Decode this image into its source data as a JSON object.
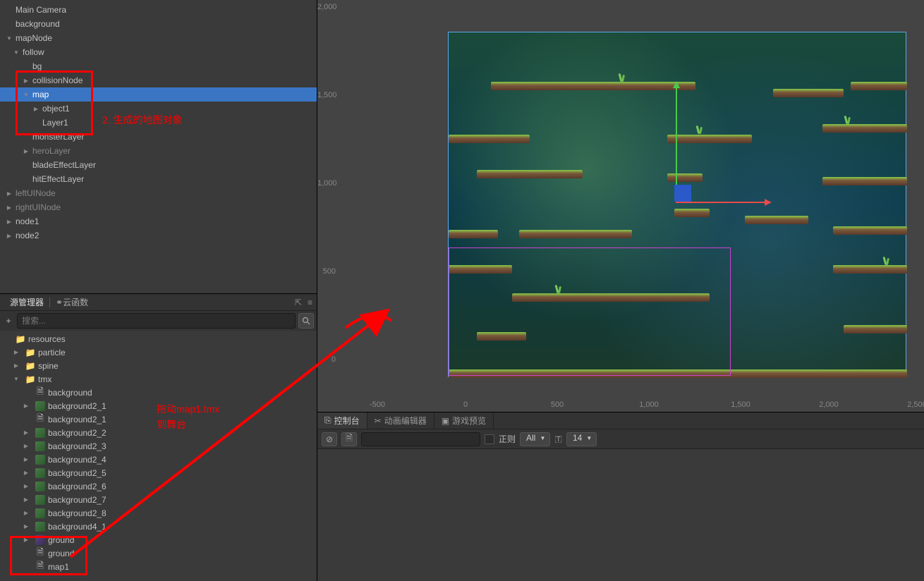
{
  "hierarchy": {
    "items": [
      {
        "label": "Main Camera",
        "indent": 0,
        "arrow": "none"
      },
      {
        "label": "background",
        "indent": 0,
        "arrow": "none"
      },
      {
        "label": "mapNode",
        "indent": 0,
        "arrow": "open"
      },
      {
        "label": "follow",
        "indent": 1,
        "arrow": "open"
      },
      {
        "label": "bg",
        "indent": 2,
        "arrow": "none"
      },
      {
        "label": "collisionNode",
        "indent": 2,
        "arrow": "closed"
      },
      {
        "label": "map",
        "indent": 2,
        "arrow": "open",
        "selected": true
      },
      {
        "label": "object1",
        "indent": 3,
        "arrow": "closed"
      },
      {
        "label": "Layer1",
        "indent": 3,
        "arrow": "none"
      },
      {
        "label": "monsterLayer",
        "indent": 2,
        "arrow": "none"
      },
      {
        "label": "heroLayer",
        "indent": 2,
        "arrow": "closed",
        "dim": true
      },
      {
        "label": "bladeEffectLayer",
        "indent": 2,
        "arrow": "none"
      },
      {
        "label": "hitEffectLayer",
        "indent": 2,
        "arrow": "none"
      },
      {
        "label": "leftUINode",
        "indent": 0,
        "arrow": "closed",
        "dim": true
      },
      {
        "label": "rightUINode",
        "indent": 0,
        "arrow": "closed",
        "dim": true
      },
      {
        "label": "node1",
        "indent": 0,
        "arrow": "closed"
      },
      {
        "label": "node2",
        "indent": 0,
        "arrow": "closed"
      }
    ]
  },
  "assets": {
    "tabs": {
      "manager": "源管理器",
      "cloud": "云函数"
    },
    "search_placeholder": "搜索...",
    "tree": [
      {
        "label": "resources",
        "indent": 0,
        "arrow": "none",
        "icon": "folder"
      },
      {
        "label": "particle",
        "indent": 1,
        "arrow": "closed",
        "icon": "folder"
      },
      {
        "label": "spine",
        "indent": 1,
        "arrow": "closed",
        "icon": "folder"
      },
      {
        "label": "tmx",
        "indent": 1,
        "arrow": "open",
        "icon": "folder"
      },
      {
        "label": "background",
        "indent": 2,
        "arrow": "none",
        "icon": "file"
      },
      {
        "label": "background2_1",
        "indent": 2,
        "arrow": "closed",
        "icon": "img"
      },
      {
        "label": "background2_1",
        "indent": 2,
        "arrow": "none",
        "icon": "file"
      },
      {
        "label": "background2_2",
        "indent": 2,
        "arrow": "closed",
        "icon": "img"
      },
      {
        "label": "background2_3",
        "indent": 2,
        "arrow": "closed",
        "icon": "img"
      },
      {
        "label": "background2_4",
        "indent": 2,
        "arrow": "closed",
        "icon": "img"
      },
      {
        "label": "background2_5",
        "indent": 2,
        "arrow": "closed",
        "icon": "img"
      },
      {
        "label": "background2_6",
        "indent": 2,
        "arrow": "closed",
        "icon": "img"
      },
      {
        "label": "background2_7",
        "indent": 2,
        "arrow": "closed",
        "icon": "img"
      },
      {
        "label": "background2_8",
        "indent": 2,
        "arrow": "closed",
        "icon": "img"
      },
      {
        "label": "background4_1",
        "indent": 2,
        "arrow": "closed",
        "icon": "img"
      },
      {
        "label": "ground",
        "indent": 2,
        "arrow": "closed",
        "icon": "img2"
      },
      {
        "label": "ground",
        "indent": 2,
        "arrow": "none",
        "icon": "file"
      },
      {
        "label": "map1",
        "indent": 2,
        "arrow": "none",
        "icon": "file"
      }
    ]
  },
  "viewport": {
    "ruler_v": [
      "2,000",
      "1,500",
      "1,000",
      "500",
      "0"
    ],
    "ruler_h": [
      "-500",
      "0",
      "500",
      "1,000",
      "1,500",
      "2,000",
      "2,500"
    ]
  },
  "bottom_tabs": {
    "console": "控制台",
    "anim": "动画编辑器",
    "preview": "游戏预览"
  },
  "console_toolbar": {
    "regex": "正则",
    "filter": "All",
    "fontsize": "14"
  },
  "annotations": {
    "note1": "2. 生成的地图对象",
    "note2_line1": "拖动map1.tmx",
    "note2_line2": "到舞台"
  }
}
